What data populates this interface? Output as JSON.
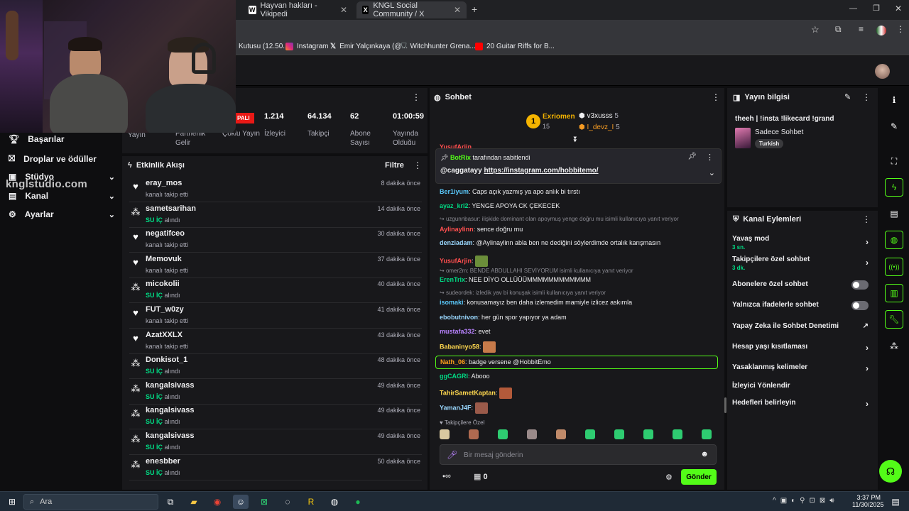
{
  "browser": {
    "tabs": [
      {
        "title": "Hayvan hakları - Vikipedi",
        "favicon": "W"
      },
      {
        "title": "KNGL Social Community / X",
        "favicon": "X"
      }
    ],
    "bookmarks": [
      {
        "label": "Kutusu (12.50...",
        "icon": "mail-icon"
      },
      {
        "label": "Instagram",
        "icon": "instagram-icon"
      },
      {
        "label": "Emir Yalçınkaya (@...",
        "icon": "x-icon"
      },
      {
        "label": "Witchhunter Grena...",
        "icon": "shield-icon"
      },
      {
        "label": "20 Guitar Riffs for B...",
        "icon": "youtube-icon"
      }
    ]
  },
  "left_nav": {
    "items": [
      {
        "label": "Başarılar",
        "icon": "trophy-icon"
      },
      {
        "label": "Droplar ve ödüller",
        "icon": "gift-icon"
      },
      {
        "label": "Stüdyo",
        "icon": "studio-icon"
      },
      {
        "label": "Kanal",
        "icon": "channel-icon"
      },
      {
        "label": "Ayarlar",
        "icon": "gear-icon"
      }
    ],
    "watermark": "knɡlstudio.com"
  },
  "stats": {
    "badge": "PALI",
    "items": [
      {
        "value": "",
        "label": "Yayın"
      },
      {
        "value": "",
        "label": "Partnerlik Gelir"
      },
      {
        "value": "",
        "label": "Çoklu Yayın"
      },
      {
        "value": "1.214",
        "label": "İzleyici"
      },
      {
        "value": "64.134",
        "label": "Takipçi"
      },
      {
        "value": "62",
        "label": "Abone Sayısı"
      },
      {
        "value": "01:00:59",
        "label": "Yayında Olduğu Süre"
      }
    ]
  },
  "activity": {
    "title": "Etkinlik Akışı",
    "filter": "Filtre",
    "items": [
      {
        "name": "eray_mos",
        "sub": "kanalı takip etti",
        "time": "8 dakika önce",
        "type": "follow"
      },
      {
        "name": "sametsarihan",
        "sub_b": "SU İÇ",
        "sub": " alındı",
        "time": "14 dakika önce",
        "type": "reward"
      },
      {
        "name": "negatifceo",
        "sub": "kanalı takip etti",
        "time": "30 dakika önce",
        "type": "follow"
      },
      {
        "name": "Memovuk",
        "sub": "kanalı takip etti",
        "time": "37 dakika önce",
        "type": "follow"
      },
      {
        "name": "micokolii",
        "sub_b": "SU İÇ",
        "sub": " alındı",
        "time": "40 dakika önce",
        "type": "reward"
      },
      {
        "name": "FUT_w0zy",
        "sub": "kanalı takip etti",
        "time": "41 dakika önce",
        "type": "follow"
      },
      {
        "name": "AzatXXLX",
        "sub": "kanalı takip etti",
        "time": "43 dakika önce",
        "type": "follow"
      },
      {
        "name": "Donkisot_1",
        "sub_b": "SU İÇ",
        "sub": " alındı",
        "time": "48 dakika önce",
        "type": "reward"
      },
      {
        "name": "kangalsivass",
        "sub_b": "SU İÇ",
        "sub": " alındı",
        "time": "49 dakika önce",
        "type": "reward"
      },
      {
        "name": "kangalsivass",
        "sub_b": "SU İÇ",
        "sub": " alındı",
        "time": "49 dakika önce",
        "type": "reward"
      },
      {
        "name": "kangalsivass",
        "sub_b": "SU İÇ",
        "sub": " alındı",
        "time": "49 dakika önce",
        "type": "reward"
      },
      {
        "name": "enesbber",
        "sub_b": "SU İÇ",
        "sub": " alındı",
        "time": "50 dakika önce",
        "type": "reward"
      }
    ]
  },
  "chat": {
    "title": "Sohbet",
    "leaders": {
      "first_name": "Exriomen",
      "first_rank": "1",
      "first_count": "15",
      "second_name": "v3xusss",
      "second_count": "5",
      "third_name": "I_devz_I",
      "third_count": "5"
    },
    "pinned": {
      "user": "BotRix",
      "text": "tarafından sabitlendi",
      "message_user": "@caggatayy",
      "message_link": "https://instagram.com/hobbitemo/"
    },
    "partial_top": "YusufArjin",
    "messages": [
      {
        "user": "Ber1iyum",
        "text": "Caps açık yazmış ya apo anlık bi tırstı",
        "color": "#5ac8fa"
      },
      {
        "user": "ayaz_krl2",
        "text": "YENGE APOYA CK ÇEKECEK",
        "color": "#00db84"
      },
      {
        "reply": "uzgunnbasur: ilişkide dominant olan apoymuş yenge doğru mu isimli kullanıcıya yanıt veriyor"
      },
      {
        "user": "Aylinaylinn",
        "text": "sence doğru mu",
        "color": "#ff4f4f"
      },
      {
        "user": "denziadam",
        "text": "@Aylinaylinn abla ben ne dediğini söylerdimde ortalık karışmasın",
        "color": "#9ad8ff"
      },
      {
        "user": "YusufArjin",
        "text": "",
        "color": "#ff4f4f",
        "emote": true
      },
      {
        "reply": "omer2m: BENDE ABDULLAHI SEVİYORUM isimli kullanıcıya yanıt veriyor"
      },
      {
        "user": "ErenTrix",
        "text": "NEE DİYO OLLÜÜÜMMMMMMMMMMMM",
        "color": "#00db84"
      },
      {
        "reply": "sudeordek: izledik yav bi konuşak isimli kullanıcıya yanıt veriyor"
      },
      {
        "user": "isomaki",
        "text": "konusamayız ben daha izlemedim mamiyle izlicez askımla",
        "color": "#5ac8fa"
      },
      {
        "user": "ebobutnivon",
        "text": "her gün spor yapıyor ya adam",
        "color": "#9ad8ff"
      },
      {
        "user": "mustafa332",
        "text": "evet",
        "color": "#b983ff"
      },
      {
        "user": "Babaninyo58",
        "text": "",
        "color": "#ffd84f",
        "emote": true
      },
      {
        "user": "Nath_06",
        "text": "badge versene @HobbitEmo",
        "color": "#ff9f1a",
        "highlight": true
      },
      {
        "user": "ggCAGRI",
        "text": "Abooo",
        "color": "#00db84"
      },
      {
        "user": "TahirSametKaptan",
        "text": "",
        "color": "#ffd84f",
        "emote": true
      },
      {
        "user": "YamanJ4F",
        "text": "",
        "color": "#9ad8ff",
        "emote": true
      }
    ],
    "followers_only_label": "Takipçilere Özel",
    "input_placeholder": "Bir mesaj gönderin",
    "points": "0",
    "send_label": "Gönder"
  },
  "stream_info": {
    "title": "Yayın bilgisi",
    "stream_title": "theeh | !insta !likecard !grand",
    "category": "Sadece Sohbet",
    "tag": "Turkish"
  },
  "channel_actions": {
    "title": "Kanal Eylemleri",
    "items": [
      {
        "label": "Yavaş mod",
        "sub": "3 sn.",
        "control": "chevron"
      },
      {
        "label": "Takipçilere özel sohbet",
        "sub": "3 dk.",
        "control": "chevron"
      },
      {
        "label": "Abonelere özel sohbet",
        "sub": "",
        "control": "toggle"
      },
      {
        "label": "Yalnızca ifadelerle sohbet",
        "sub": "",
        "control": "toggle"
      },
      {
        "label": "Yapay Zeka ile Sohbet Denetimi",
        "sub": "",
        "control": "external"
      },
      {
        "label": "Hesap yaşı kısıtlaması",
        "sub": "",
        "control": "chevron"
      },
      {
        "label": "Yasaklanmış kelimeler",
        "sub": "",
        "control": "chevron"
      },
      {
        "label": "İzleyici Yönlendir",
        "sub": "",
        "control": "none"
      },
      {
        "label": "Hedefleri belirleyin",
        "sub": "",
        "control": "chevron"
      }
    ]
  },
  "taskbar": {
    "search_placeholder": "Ara",
    "time": "3:37 PM",
    "date": "11/30/2025"
  },
  "colors": {
    "accent": "#53fc18",
    "panel": "#18181b",
    "background": "#0e0e10"
  }
}
